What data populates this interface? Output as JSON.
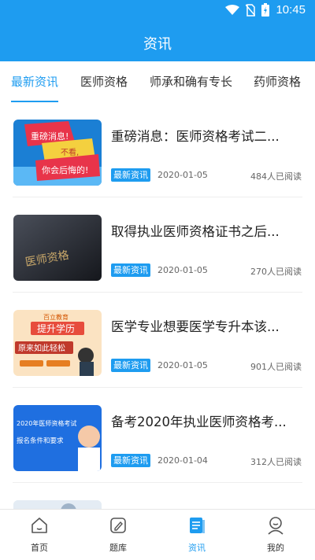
{
  "status": {
    "time": "10:45"
  },
  "header": {
    "title": "资讯"
  },
  "tabs": [
    {
      "label": "最新资讯",
      "active": true
    },
    {
      "label": "医师资格",
      "active": false
    },
    {
      "label": "师承和确有专长",
      "active": false
    },
    {
      "label": "药师资格",
      "active": false
    }
  ],
  "articles": [
    {
      "title": "重磅消息：医师资格考试二...",
      "badge": "最新资讯",
      "date": "2020-01-05",
      "reads": "484人已阅读",
      "thumb": {
        "line1": "重磅消息!",
        "line2": "不看,",
        "line3": "你会后悔的!"
      }
    },
    {
      "title": "取得执业医师资格证书之后...",
      "badge": "最新资讯",
      "date": "2020-01-05",
      "reads": "270人已阅读",
      "thumb": {
        "text": "医师资格"
      }
    },
    {
      "title": "医学专业想要医学专升本该...",
      "badge": "最新资讯",
      "date": "2020-01-05",
      "reads": "901人已阅读",
      "thumb": {
        "brand": "百立教育",
        "headline": "提升学历",
        "banner": "原来如此轻松"
      }
    },
    {
      "title": "备考2020年执业医师资格考...",
      "badge": "最新资讯",
      "date": "2020-01-04",
      "reads": "312人已阅读",
      "thumb": {
        "line1": "2020年医师资格考试",
        "line2": "报名条件和要求"
      }
    }
  ],
  "bottom_nav": [
    {
      "label": "首页",
      "icon": "home-icon",
      "active": false
    },
    {
      "label": "题库",
      "icon": "edit-icon",
      "active": false
    },
    {
      "label": "资讯",
      "icon": "news-icon",
      "active": true
    },
    {
      "label": "我的",
      "icon": "user-icon",
      "active": false
    }
  ],
  "colors": {
    "primary": "#1e9cf0"
  }
}
